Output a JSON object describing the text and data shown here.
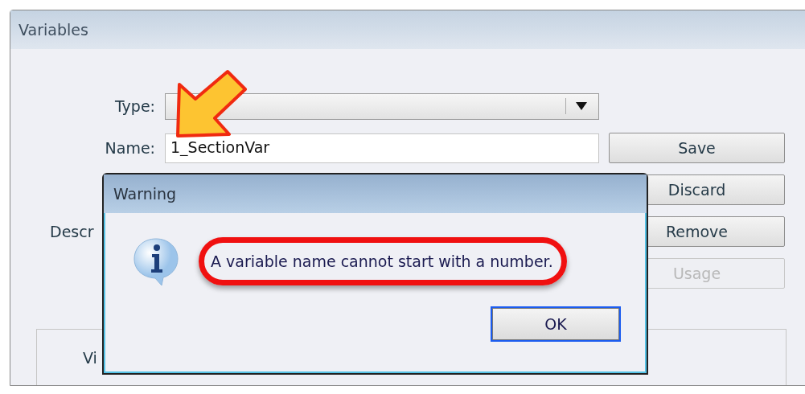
{
  "window": {
    "title": "Variables"
  },
  "type_field": {
    "label": "Type:"
  },
  "name_field": {
    "label": "Name:",
    "value": "1_SectionVar"
  },
  "description_label": "Descr",
  "buttons": [
    {
      "label": "Save",
      "disabled": false
    },
    {
      "label": "Discard",
      "disabled": false
    },
    {
      "label": "Remove",
      "disabled": false
    },
    {
      "label": "Usage",
      "disabled": true
    }
  ],
  "group_box": {
    "label": "Vi"
  },
  "dialog": {
    "title": "Warning",
    "message": "A variable name cannot start with a number.",
    "button": {
      "label": "OK",
      "focused": true
    }
  }
}
